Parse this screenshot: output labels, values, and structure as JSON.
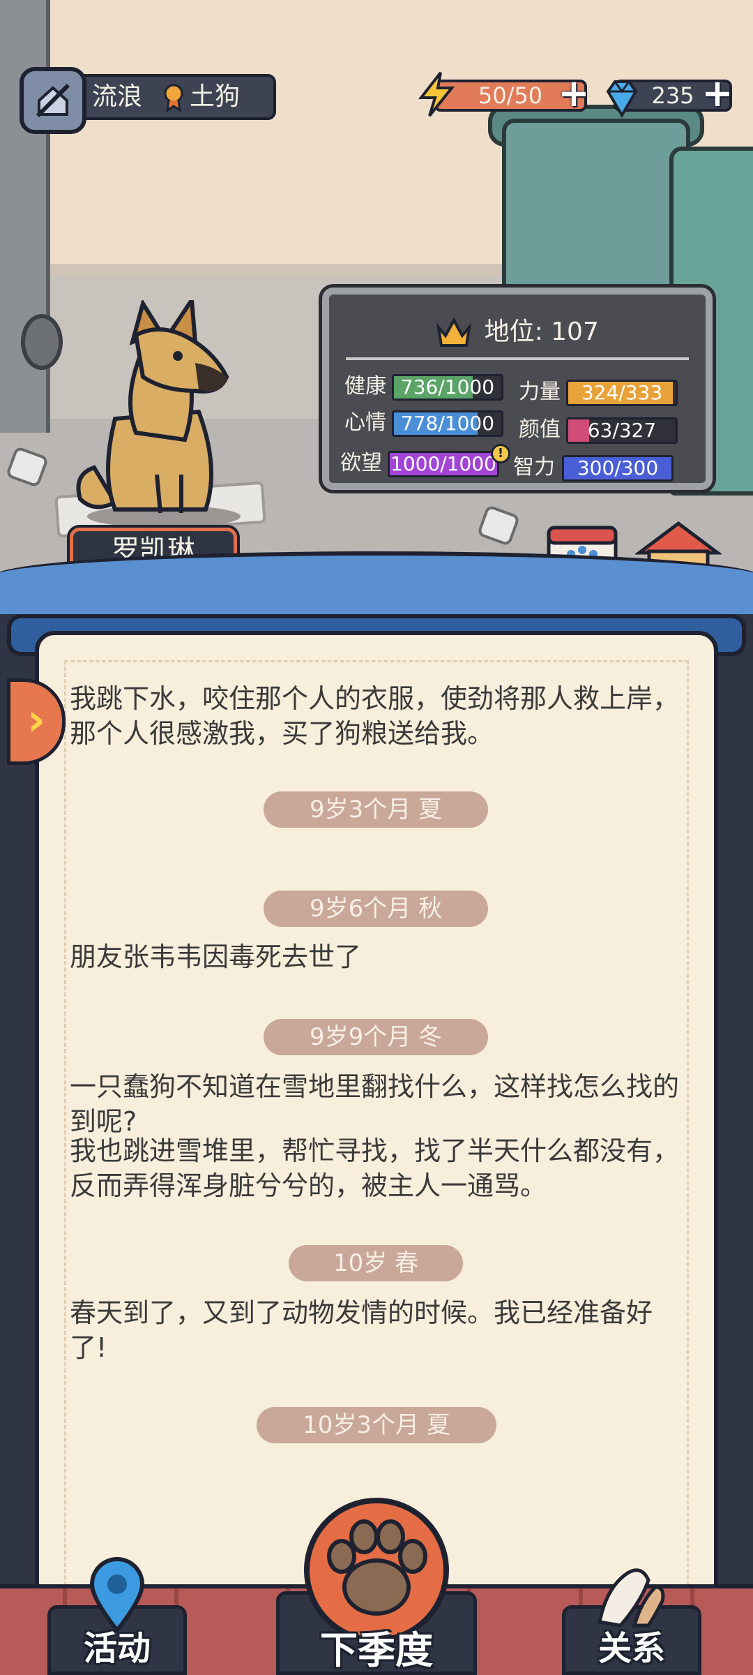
{
  "hud": {
    "state": "流浪",
    "breed": "土狗",
    "energy": "50/50",
    "gems": "235"
  },
  "dog": {
    "name": "罗凯琳"
  },
  "stats": {
    "status_label": "地位: 107",
    "health": {
      "label": "健康",
      "value": "736/1000",
      "fraction": 0.736,
      "color": "#5aa468"
    },
    "strength": {
      "label": "力量",
      "value": "324/333",
      "fraction": 0.973,
      "color": "#e8a23a"
    },
    "mood": {
      "label": "心情",
      "value": "778/1000",
      "fraction": 0.778,
      "color": "#4a8fd6"
    },
    "looks": {
      "label": "颜值",
      "value": "63/327",
      "fraction": 0.193,
      "color": "#d14c78"
    },
    "desire": {
      "label": "欲望",
      "value": "1000/1000",
      "fraction": 1.0,
      "color": "#a245d6"
    },
    "intellect": {
      "label": "智力",
      "value": "300/300",
      "fraction": 1.0,
      "color": "#4a5ed6"
    }
  },
  "side": {
    "tasks_label": "任务",
    "kennel_label": "狗窝"
  },
  "journal": {
    "entry1": "我跳下水，咬住那个人的衣服，使劲将那人救上岸，那个人很感激我，买了狗粮送给我。",
    "chip1": "9岁3个月 夏",
    "chip2": "9岁6个月 秋",
    "entry2": "朋友张韦韦因毒死去世了",
    "chip3": "9岁9个月 冬",
    "entry3a": "一只蠢狗不知道在雪地里翻找什么，这样找怎么找的到呢?",
    "entry3b": "我也跳进雪堆里，帮忙寻找，找了半天什么都没有，反而弄得浑身脏兮兮的，被主人一通骂。",
    "chip4": "10岁 春",
    "entry4": "春天到了，又到了动物发情的时候。我已经准备好了!",
    "chip5": "10岁3个月 夏"
  },
  "nav": {
    "activity": "活动",
    "next_season": "下季度",
    "relations": "关系"
  }
}
